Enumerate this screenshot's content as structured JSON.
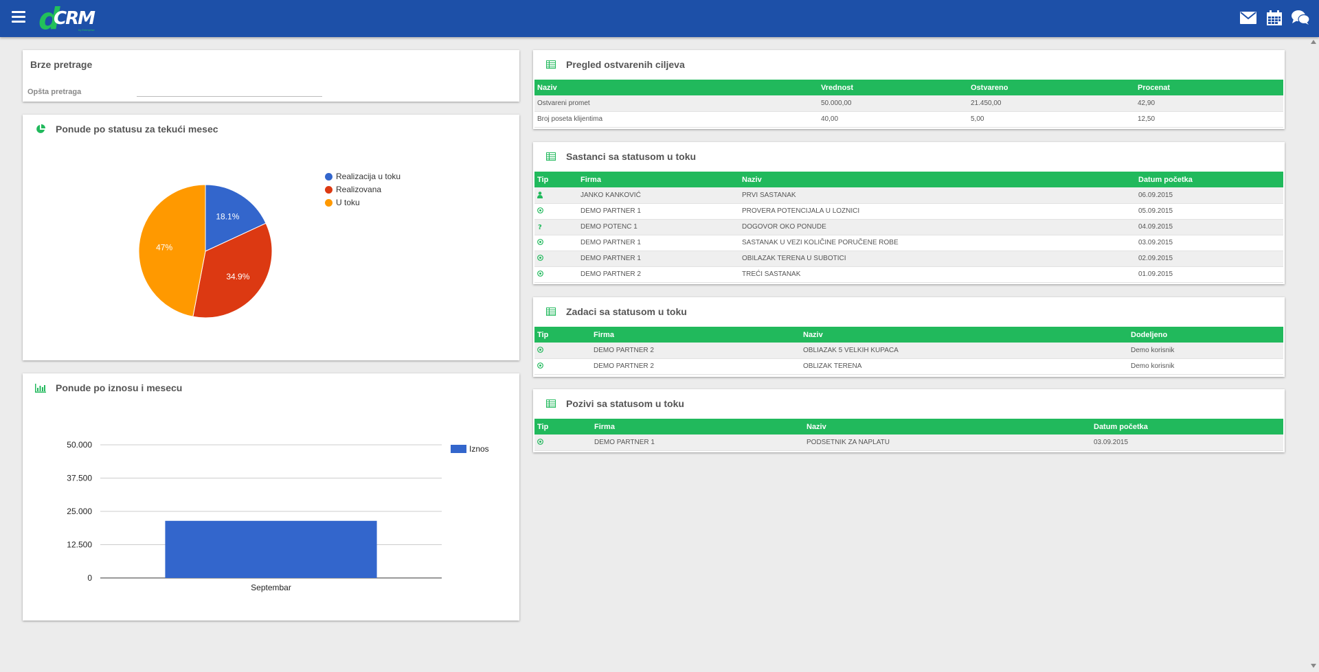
{
  "app": {
    "logo_d": "d",
    "logo_crm": "CRM",
    "logo_sub": "by Enterprise"
  },
  "header_icons": [
    "envelope-icon",
    "calendar-icon",
    "chat-icon"
  ],
  "colors": {
    "topbar": "#1d50a8",
    "accent": "#21b95c",
    "slice_blue": "#3366cc",
    "slice_red": "#dc3912",
    "slice_orange": "#ff9900"
  },
  "quick_search": {
    "title": "Brze pretrage",
    "label": "Opšta pretraga",
    "value": "",
    "placeholder": ""
  },
  "pie_panel": {
    "title": "Ponude po statusu za tekući mesec",
    "slice_labels": [
      "18.1%",
      "34.9%",
      "47%"
    ]
  },
  "bar_panel": {
    "title": "Ponude po iznosu i mesecu",
    "tick_labels": [
      "50.000",
      "37.500",
      "25.000",
      "12.500",
      "0"
    ],
    "category_labels": [
      "Septembar"
    ],
    "legend": "Iznos"
  },
  "chart_data": [
    {
      "type": "pie",
      "title": "Ponude po statusu za tekući mesec",
      "categories": [
        "Realizacija u toku",
        "Realizovana",
        "U toku"
      ],
      "values": [
        18.1,
        34.9,
        47.0
      ],
      "legend_placement": "right"
    },
    {
      "type": "bar",
      "title": "Ponude po iznosu i mesecu",
      "categories": [
        "Septembar"
      ],
      "series": [
        {
          "name": "Iznos",
          "values": [
            21450
          ]
        }
      ],
      "ylim": [
        0,
        50000
      ],
      "yticks": [
        0,
        12500,
        25000,
        37500,
        50000
      ],
      "grid": true,
      "legend_placement": "top-right"
    }
  ],
  "goals": {
    "title": "Pregled ostvarenih ciljeva",
    "columns": [
      "Naziv",
      "Vrednost",
      "Ostvareno",
      "Procenat"
    ],
    "rows": [
      [
        "Ostvareni promet",
        "50.000,00",
        "21.450,00",
        "42,90"
      ],
      [
        "Broj poseta klijentima",
        "40,00",
        "5,00",
        "12,50"
      ]
    ]
  },
  "meetings": {
    "title": "Sastanci sa statusom u toku",
    "columns": [
      "Tip",
      "Firma",
      "Naziv",
      "Datum početka"
    ],
    "rows": [
      {
        "tip": "person-icon",
        "firma": "JANKO KANKOVIĆ",
        "naziv": "PRVI SASTANAK",
        "datum": "06.09.2015"
      },
      {
        "tip": "target-icon",
        "firma": "DEMO PARTNER 1",
        "naziv": "PROVERA POTENCIJALA U LOZNICI",
        "datum": "05.09.2015"
      },
      {
        "tip": "question-icon",
        "firma": "DEMO POTENC 1",
        "naziv": "DOGOVOR OKO PONUDE",
        "datum": "04.09.2015"
      },
      {
        "tip": "target-icon",
        "firma": "DEMO PARTNER 1",
        "naziv": "SASTANAK U VEZI KOLIČINE PORUČENE ROBE",
        "datum": "03.09.2015"
      },
      {
        "tip": "target-icon",
        "firma": "DEMO PARTNER 1",
        "naziv": "OBILAZAK TERENA U SUBOTICI",
        "datum": "02.09.2015"
      },
      {
        "tip": "target-icon",
        "firma": "DEMO PARTNER 2",
        "naziv": "TREĆI SASTANAK",
        "datum": "01.09.2015"
      }
    ]
  },
  "tasks": {
    "title": "Zadaci sa statusom u toku",
    "columns": [
      "Tip",
      "Firma",
      "Naziv",
      "Dodeljeno"
    ],
    "rows": [
      {
        "tip": "target-icon",
        "firma": "DEMO PARTNER 2",
        "naziv": "OBLIAZAK 5 VELKIH KUPACA",
        "dodeljeno": "Demo korisnik"
      },
      {
        "tip": "target-icon",
        "firma": "DEMO PARTNER 2",
        "naziv": "OBLIZAK TERENA",
        "dodeljeno": "Demo korisnik"
      }
    ]
  },
  "calls": {
    "title": "Pozivi sa statusom u toku",
    "columns": [
      "Tip",
      "Firma",
      "Naziv",
      "Datum početka"
    ],
    "rows": [
      {
        "tip": "target-icon",
        "firma": "DEMO PARTNER 1",
        "naziv": "PODSETNIK ZA NAPLATU",
        "datum": "03.09.2015"
      }
    ]
  }
}
